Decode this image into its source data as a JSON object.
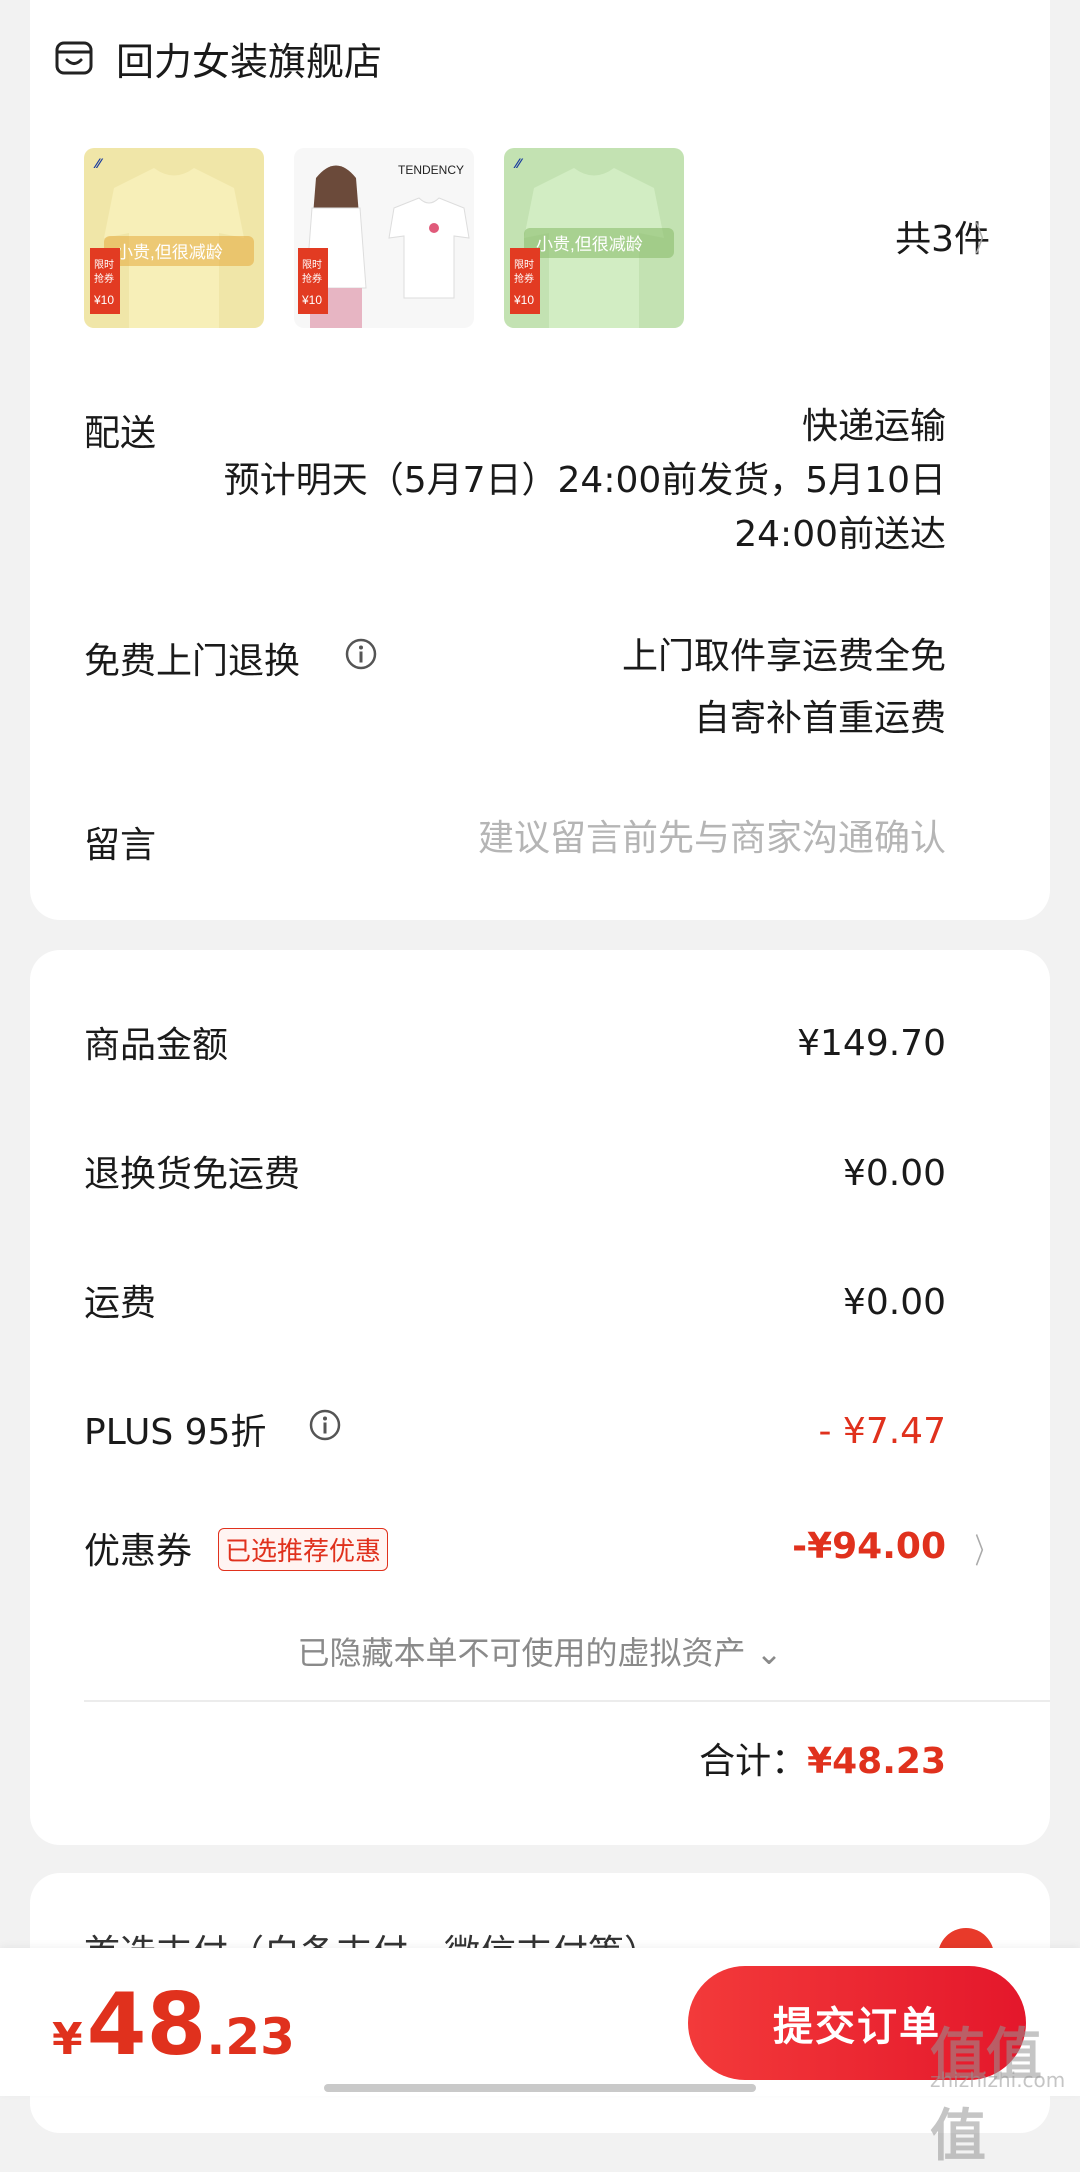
{
  "shop": {
    "name": "回力女装旗舰店",
    "icon": "shop-icon"
  },
  "products": {
    "count_label": "共3件",
    "items": [
      {
        "alt": "yellow-tshirt",
        "banner": "小贵,但很减龄",
        "badge_top": "限时\n抢券",
        "badge_price": "¥10",
        "color": "#f2e7a2"
      },
      {
        "alt": "white-tshirt-model",
        "brand": "TENDENCY",
        "badge_top": "限时\n抢券",
        "badge_price": "¥10",
        "color": "#f7f7f7"
      },
      {
        "alt": "green-tshirt",
        "banner": "小贵,但很减龄",
        "badge_top": "限时\n抢券",
        "badge_price": "¥10",
        "color": "#c6e6b6"
      }
    ]
  },
  "delivery": {
    "label": "配送",
    "method": "快递运输",
    "estimate_line1": "预计明天（5月7日）24:00前发货，5月10日",
    "estimate_line2": "24:00前送达"
  },
  "return": {
    "label": "免费上门退换",
    "line1": "上门取件享运费全免",
    "line2": "自寄补首重运费"
  },
  "message": {
    "label": "留言",
    "placeholder": "建议留言前先与商家沟通确认"
  },
  "summary": {
    "goods_amount_label": "商品金额",
    "goods_amount": "¥149.70",
    "return_free_label": "退换货免运费",
    "return_free": "¥0.00",
    "shipping_label": "运费",
    "shipping": "¥0.00",
    "plus_label": "PLUS 95折",
    "plus_discount": "- ¥7.47",
    "coupon_label": "优惠券",
    "coupon_tag": "已选推荐优惠",
    "coupon_discount": "-¥94.00",
    "hidden_assets": "已隐藏本单不可使用的虚拟资产 ⌄",
    "total_label": "合计：",
    "total": "¥48.23"
  },
  "payment_partial": "首选支付（白条支付，微信支付等）",
  "bottom": {
    "price_symbol": "¥",
    "price_int": "48",
    "price_dec": ".23",
    "submit_label": "提交订单"
  },
  "watermark": {
    "main": "值值值",
    "sub": "zhizhizhi.com"
  },
  "colors": {
    "accent_red": "#e0311d",
    "button_red": "#f23030"
  }
}
